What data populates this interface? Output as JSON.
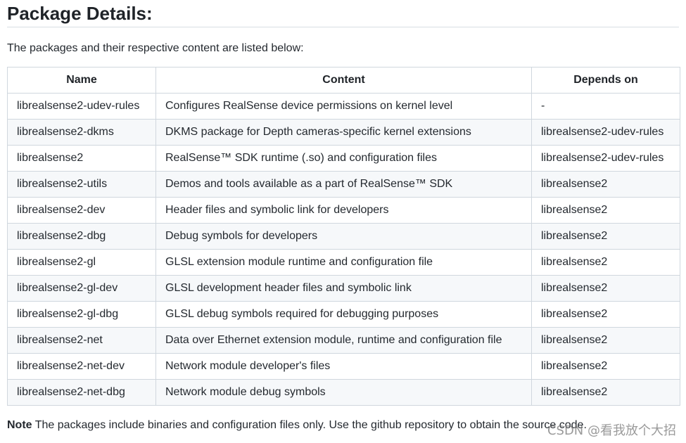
{
  "heading": "Package Details:",
  "intro": "The packages and their respective content are listed below:",
  "table": {
    "headers": [
      "Name",
      "Content",
      "Depends on"
    ],
    "rows": [
      [
        "librealsense2-udev-rules",
        "Configures RealSense device permissions on kernel level",
        "-"
      ],
      [
        "librealsense2-dkms",
        "DKMS package for Depth cameras-specific kernel extensions",
        "librealsense2-udev-rules"
      ],
      [
        "librealsense2",
        "RealSense™ SDK runtime (.so) and configuration files",
        "librealsense2-udev-rules"
      ],
      [
        "librealsense2-utils",
        "Demos and tools available as a part of RealSense™ SDK",
        "librealsense2"
      ],
      [
        "librealsense2-dev",
        "Header files and symbolic link for developers",
        "librealsense2"
      ],
      [
        "librealsense2-dbg",
        "Debug symbols for developers",
        "librealsense2"
      ],
      [
        "librealsense2-gl",
        "GLSL extension module runtime and configuration file",
        "librealsense2"
      ],
      [
        "librealsense2-gl-dev",
        "GLSL development header files and symbolic link",
        "librealsense2"
      ],
      [
        "librealsense2-gl-dbg",
        "GLSL debug symbols required for debugging purposes",
        "librealsense2"
      ],
      [
        "librealsense2-net",
        "Data over Ethernet extension module, runtime and configuration file",
        "librealsense2"
      ],
      [
        "librealsense2-net-dev",
        "Network module developer's files",
        "librealsense2"
      ],
      [
        "librealsense2-net-dbg",
        "Network module debug symbols",
        "librealsense2"
      ]
    ]
  },
  "note": {
    "label": "Note",
    "text": " The packages include binaries and configuration files only. Use the github repository to obtain the source code."
  },
  "watermark": "CSDN @看我放个大招"
}
